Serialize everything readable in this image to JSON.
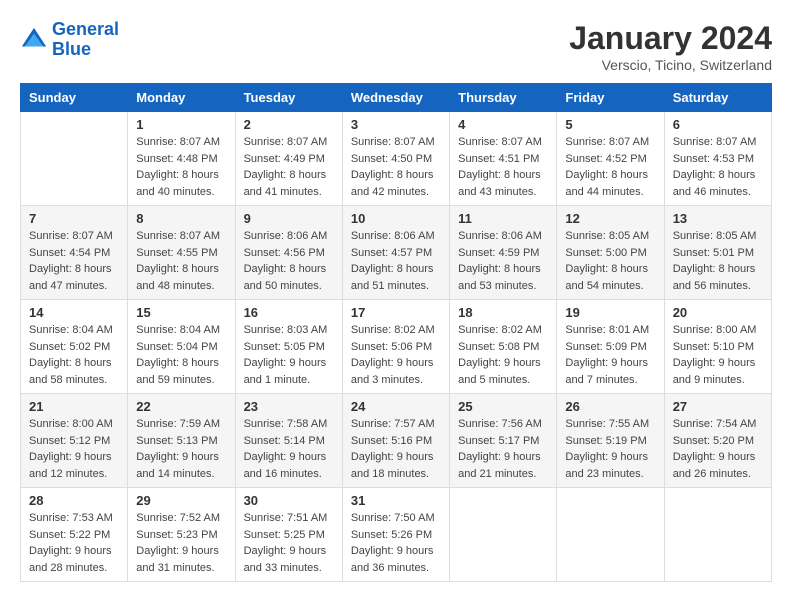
{
  "logo": {
    "line1": "General",
    "line2": "Blue"
  },
  "title": "January 2024",
  "location": "Verscio, Ticino, Switzerland",
  "weekdays": [
    "Sunday",
    "Monday",
    "Tuesday",
    "Wednesday",
    "Thursday",
    "Friday",
    "Saturday"
  ],
  "weeks": [
    [
      {
        "day": "",
        "sunrise": "",
        "sunset": "",
        "daylight": ""
      },
      {
        "day": "1",
        "sunrise": "Sunrise: 8:07 AM",
        "sunset": "Sunset: 4:48 PM",
        "daylight": "Daylight: 8 hours and 40 minutes."
      },
      {
        "day": "2",
        "sunrise": "Sunrise: 8:07 AM",
        "sunset": "Sunset: 4:49 PM",
        "daylight": "Daylight: 8 hours and 41 minutes."
      },
      {
        "day": "3",
        "sunrise": "Sunrise: 8:07 AM",
        "sunset": "Sunset: 4:50 PM",
        "daylight": "Daylight: 8 hours and 42 minutes."
      },
      {
        "day": "4",
        "sunrise": "Sunrise: 8:07 AM",
        "sunset": "Sunset: 4:51 PM",
        "daylight": "Daylight: 8 hours and 43 minutes."
      },
      {
        "day": "5",
        "sunrise": "Sunrise: 8:07 AM",
        "sunset": "Sunset: 4:52 PM",
        "daylight": "Daylight: 8 hours and 44 minutes."
      },
      {
        "day": "6",
        "sunrise": "Sunrise: 8:07 AM",
        "sunset": "Sunset: 4:53 PM",
        "daylight": "Daylight: 8 hours and 46 minutes."
      }
    ],
    [
      {
        "day": "7",
        "sunrise": "Sunrise: 8:07 AM",
        "sunset": "Sunset: 4:54 PM",
        "daylight": "Daylight: 8 hours and 47 minutes."
      },
      {
        "day": "8",
        "sunrise": "Sunrise: 8:07 AM",
        "sunset": "Sunset: 4:55 PM",
        "daylight": "Daylight: 8 hours and 48 minutes."
      },
      {
        "day": "9",
        "sunrise": "Sunrise: 8:06 AM",
        "sunset": "Sunset: 4:56 PM",
        "daylight": "Daylight: 8 hours and 50 minutes."
      },
      {
        "day": "10",
        "sunrise": "Sunrise: 8:06 AM",
        "sunset": "Sunset: 4:57 PM",
        "daylight": "Daylight: 8 hours and 51 minutes."
      },
      {
        "day": "11",
        "sunrise": "Sunrise: 8:06 AM",
        "sunset": "Sunset: 4:59 PM",
        "daylight": "Daylight: 8 hours and 53 minutes."
      },
      {
        "day": "12",
        "sunrise": "Sunrise: 8:05 AM",
        "sunset": "Sunset: 5:00 PM",
        "daylight": "Daylight: 8 hours and 54 minutes."
      },
      {
        "day": "13",
        "sunrise": "Sunrise: 8:05 AM",
        "sunset": "Sunset: 5:01 PM",
        "daylight": "Daylight: 8 hours and 56 minutes."
      }
    ],
    [
      {
        "day": "14",
        "sunrise": "Sunrise: 8:04 AM",
        "sunset": "Sunset: 5:02 PM",
        "daylight": "Daylight: 8 hours and 58 minutes."
      },
      {
        "day": "15",
        "sunrise": "Sunrise: 8:04 AM",
        "sunset": "Sunset: 5:04 PM",
        "daylight": "Daylight: 8 hours and 59 minutes."
      },
      {
        "day": "16",
        "sunrise": "Sunrise: 8:03 AM",
        "sunset": "Sunset: 5:05 PM",
        "daylight": "Daylight: 9 hours and 1 minute."
      },
      {
        "day": "17",
        "sunrise": "Sunrise: 8:02 AM",
        "sunset": "Sunset: 5:06 PM",
        "daylight": "Daylight: 9 hours and 3 minutes."
      },
      {
        "day": "18",
        "sunrise": "Sunrise: 8:02 AM",
        "sunset": "Sunset: 5:08 PM",
        "daylight": "Daylight: 9 hours and 5 minutes."
      },
      {
        "day": "19",
        "sunrise": "Sunrise: 8:01 AM",
        "sunset": "Sunset: 5:09 PM",
        "daylight": "Daylight: 9 hours and 7 minutes."
      },
      {
        "day": "20",
        "sunrise": "Sunrise: 8:00 AM",
        "sunset": "Sunset: 5:10 PM",
        "daylight": "Daylight: 9 hours and 9 minutes."
      }
    ],
    [
      {
        "day": "21",
        "sunrise": "Sunrise: 8:00 AM",
        "sunset": "Sunset: 5:12 PM",
        "daylight": "Daylight: 9 hours and 12 minutes."
      },
      {
        "day": "22",
        "sunrise": "Sunrise: 7:59 AM",
        "sunset": "Sunset: 5:13 PM",
        "daylight": "Daylight: 9 hours and 14 minutes."
      },
      {
        "day": "23",
        "sunrise": "Sunrise: 7:58 AM",
        "sunset": "Sunset: 5:14 PM",
        "daylight": "Daylight: 9 hours and 16 minutes."
      },
      {
        "day": "24",
        "sunrise": "Sunrise: 7:57 AM",
        "sunset": "Sunset: 5:16 PM",
        "daylight": "Daylight: 9 hours and 18 minutes."
      },
      {
        "day": "25",
        "sunrise": "Sunrise: 7:56 AM",
        "sunset": "Sunset: 5:17 PM",
        "daylight": "Daylight: 9 hours and 21 minutes."
      },
      {
        "day": "26",
        "sunrise": "Sunrise: 7:55 AM",
        "sunset": "Sunset: 5:19 PM",
        "daylight": "Daylight: 9 hours and 23 minutes."
      },
      {
        "day": "27",
        "sunrise": "Sunrise: 7:54 AM",
        "sunset": "Sunset: 5:20 PM",
        "daylight": "Daylight: 9 hours and 26 minutes."
      }
    ],
    [
      {
        "day": "28",
        "sunrise": "Sunrise: 7:53 AM",
        "sunset": "Sunset: 5:22 PM",
        "daylight": "Daylight: 9 hours and 28 minutes."
      },
      {
        "day": "29",
        "sunrise": "Sunrise: 7:52 AM",
        "sunset": "Sunset: 5:23 PM",
        "daylight": "Daylight: 9 hours and 31 minutes."
      },
      {
        "day": "30",
        "sunrise": "Sunrise: 7:51 AM",
        "sunset": "Sunset: 5:25 PM",
        "daylight": "Daylight: 9 hours and 33 minutes."
      },
      {
        "day": "31",
        "sunrise": "Sunrise: 7:50 AM",
        "sunset": "Sunset: 5:26 PM",
        "daylight": "Daylight: 9 hours and 36 minutes."
      },
      {
        "day": "",
        "sunrise": "",
        "sunset": "",
        "daylight": ""
      },
      {
        "day": "",
        "sunrise": "",
        "sunset": "",
        "daylight": ""
      },
      {
        "day": "",
        "sunrise": "",
        "sunset": "",
        "daylight": ""
      }
    ]
  ]
}
